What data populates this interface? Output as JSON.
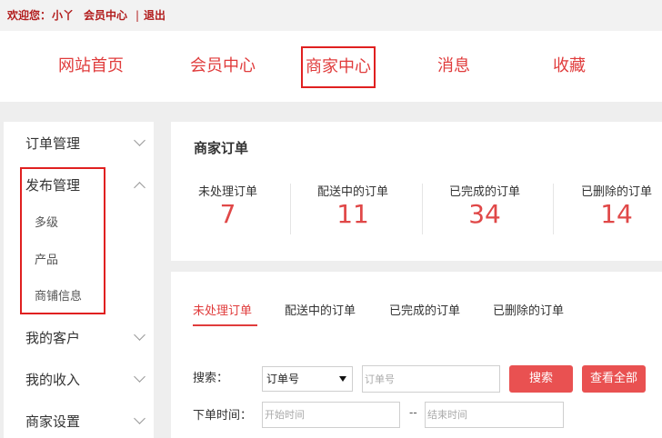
{
  "topbar": {
    "welcome": "欢迎您：",
    "username": "小丫",
    "member_center": "会员中心",
    "separator": "|",
    "logout": "退出"
  },
  "nav": {
    "items": [
      {
        "label": "网站首页"
      },
      {
        "label": "会员中心"
      },
      {
        "label": "商家中心",
        "active": true
      },
      {
        "label": "消息"
      },
      {
        "label": "收藏"
      }
    ]
  },
  "sidebar": {
    "items": [
      {
        "label": "订单管理",
        "icon": "chevron-down-icon"
      },
      {
        "label": "发布管理",
        "icon": "chevron-up-icon",
        "expanded": true,
        "children": [
          {
            "label": "多级"
          },
          {
            "label": "产品"
          },
          {
            "label": "商铺信息"
          }
        ]
      },
      {
        "label": "我的客户",
        "icon": "chevron-down-icon"
      },
      {
        "label": "我的收入",
        "icon": "chevron-down-icon"
      },
      {
        "label": "商家设置",
        "icon": "chevron-down-icon"
      }
    ]
  },
  "stats": {
    "title": "商家订单",
    "items": [
      {
        "label": "未处理订单",
        "value": "7"
      },
      {
        "label": "配送中的订单",
        "value": "11"
      },
      {
        "label": "已完成的订单",
        "value": "34"
      },
      {
        "label": "已删除的订单",
        "value": "14"
      }
    ]
  },
  "orders": {
    "tabs": [
      {
        "label": "未处理订单",
        "active": true
      },
      {
        "label": "配送中的订单"
      },
      {
        "label": "已完成的订单"
      },
      {
        "label": "已删除的订单"
      }
    ],
    "search_label": "搜索：",
    "search_type_selected": "订单号",
    "search_placeholder": "订单号",
    "search_button": "搜索",
    "view_all_button": "查看全部",
    "date_label": "下单时间：",
    "start_placeholder": "开始时间",
    "range_separator": "--",
    "end_placeholder": "结束时间"
  },
  "colors": {
    "accent": "#e03c3c",
    "button": "#e95151",
    "highlight_border": "#e02020"
  }
}
